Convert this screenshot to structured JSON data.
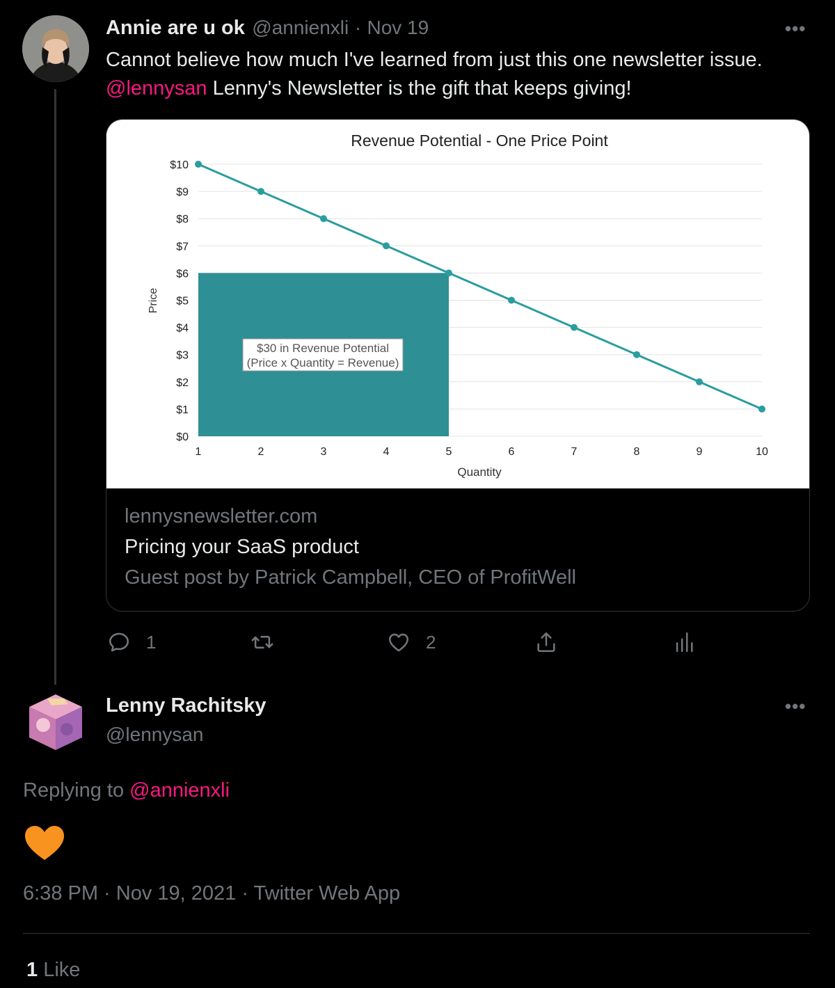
{
  "tweet": {
    "author_name": "Annie are u ok",
    "author_handle": "@annienxli",
    "separator": "·",
    "date": "Nov 19",
    "text_line1": "Cannot believe how much I've learned from just this one newsletter issue.",
    "mention": "@lennysan",
    "text_line2_rest": " Lenny's Newsletter is the gift that keeps giving!",
    "more_icon": "more-horizontal-icon",
    "card": {
      "domain": "lennysnewsletter.com",
      "title": "Pricing your SaaS product",
      "description": "Guest post by Patrick Campbell, CEO of ProfitWell"
    },
    "actions": {
      "reply_count": "1",
      "retweet_count": "",
      "like_count": "2"
    }
  },
  "chart_data": {
    "type": "line",
    "title": "Revenue Potential - One Price Point",
    "xlabel": "Quantity",
    "ylabel": "Price",
    "x": [
      1,
      2,
      3,
      4,
      5,
      6,
      7,
      8,
      9,
      10
    ],
    "series": [
      {
        "values": [
          10,
          9,
          8,
          7,
          6,
          5,
          4,
          3,
          2,
          1
        ]
      }
    ],
    "y_ticks": [
      "$0",
      "$1",
      "$2",
      "$3",
      "$4",
      "$5",
      "$6",
      "$7",
      "$8",
      "$9",
      "$10"
    ],
    "ylim": [
      0,
      10
    ],
    "xlim": [
      1,
      10
    ],
    "grid": true,
    "shaded_region": {
      "x_from": 1,
      "x_to": 5,
      "y_to": 6
    },
    "annotation_lines": [
      "$30 in Revenue Potential",
      "(Price x Quantity = Revenue)"
    ],
    "colors": {
      "line": "#2a9d9f",
      "fill": "#2e8f94"
    }
  },
  "reply": {
    "author_name": "Lenny Rachitsky",
    "author_handle": "@lennysan",
    "replying_prefix": "Replying to ",
    "replying_to": "@annienxli",
    "body_icon": "orange-heart-emoji",
    "timestamp": "6:38 PM · Nov 19, 2021 · Twitter Web App",
    "like_count": "1",
    "like_label": "Like"
  },
  "colors": {
    "background": "#000000",
    "mention": "#f91880",
    "muted": "#71767b",
    "heart": "#f7931e"
  }
}
